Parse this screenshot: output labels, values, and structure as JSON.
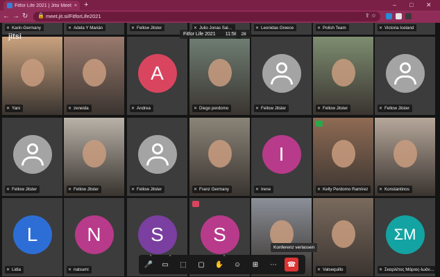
{
  "browser": {
    "tab_title": "Fitfor Life 2021 | Jitsi Meet",
    "tab_close": "×",
    "new_tab": "+",
    "url": "meet.jit.si/FitforLife2021",
    "minimize": "–",
    "maximize": "□",
    "close": "✕",
    "back": "←",
    "forward": "→",
    "reload": "↻",
    "lock": "🔒",
    "omni_icons": "⇪ ☆",
    "menu": "⋮"
  },
  "meeting": {
    "title": "Fitfor Life 2021",
    "timer": "11:58",
    "participants": "28",
    "logo": "jitsi",
    "hangup_tooltip": "Konferenz verlassen"
  },
  "top_row": [
    "Karin-Germany",
    "Adela Y Marián",
    "Fellow Jitster",
    "Julio Jonas Sal…",
    "Leonidas Greece",
    "Polish Team",
    "Victoria Iceland"
  ],
  "row1": [
    {
      "name": "Yani",
      "type": "photo",
      "color": "#c9a27e"
    },
    {
      "name": "zeneida",
      "type": "photo",
      "color": "#9a7a6d"
    },
    {
      "name": "Andrea",
      "type": "initial",
      "initial": "A",
      "color": "#d9455f"
    },
    {
      "name": "Diego perdomo",
      "type": "photo",
      "color": "#6f7f74"
    },
    {
      "name": "Fellow Jitster",
      "type": "generic"
    },
    {
      "name": "Fellow Jitster",
      "type": "photo",
      "color": "#7d8d70"
    },
    {
      "name": "Fellow Jitster",
      "type": "generic"
    }
  ],
  "row2": [
    {
      "name": "Fellow Jitster",
      "type": "generic"
    },
    {
      "name": "Fellow Jitster",
      "type": "photo",
      "color": "#b8b2a8"
    },
    {
      "name": "Fellow Jitster",
      "type": "generic"
    },
    {
      "name": "Franz Germany",
      "type": "photo",
      "color": "#8a8478"
    },
    {
      "name": "Irene",
      "type": "initial",
      "initial": "I",
      "color": "#b83a8a"
    },
    {
      "name": "Kelly Perdomo Ramírez",
      "type": "photo",
      "color": "#8f6b54"
    },
    {
      "name": "Konstantinos",
      "type": "photo",
      "color": "#b6a79a"
    }
  ],
  "row3": [
    {
      "name": "Lidia",
      "type": "initial",
      "initial": "L",
      "color": "#2d6ed6"
    },
    {
      "name": "natsumi",
      "type": "initial",
      "initial": "N",
      "color": "#b83a8a"
    },
    {
      "name": "",
      "type": "initial",
      "initial": "S",
      "color": "#7a3fa0"
    },
    {
      "name": "",
      "type": "initial",
      "initial": "S",
      "color": "#b83a8a"
    },
    {
      "name": "",
      "type": "photo",
      "color": "#8b8f97"
    },
    {
      "name": "Valsequillo",
      "type": "photo",
      "color": "#7a6a5d"
    },
    {
      "name": "Σκαρλέτος Μάριος-Ιωάν…",
      "type": "initial",
      "initial": "ΣΜ",
      "color": "#14a3a3"
    }
  ],
  "icons": {
    "mic_off": "✕",
    "mic": "🎤",
    "camera": "▭",
    "screenshare": "⬚",
    "chat": "▢",
    "raise_hand": "✋",
    "participants": "☺",
    "tile_view": "⊞",
    "more": "⋯",
    "hangup": "☎",
    "caret": "^"
  },
  "colors": {
    "browser_frame": "#8f2c57",
    "hangup": "#dd3333"
  }
}
